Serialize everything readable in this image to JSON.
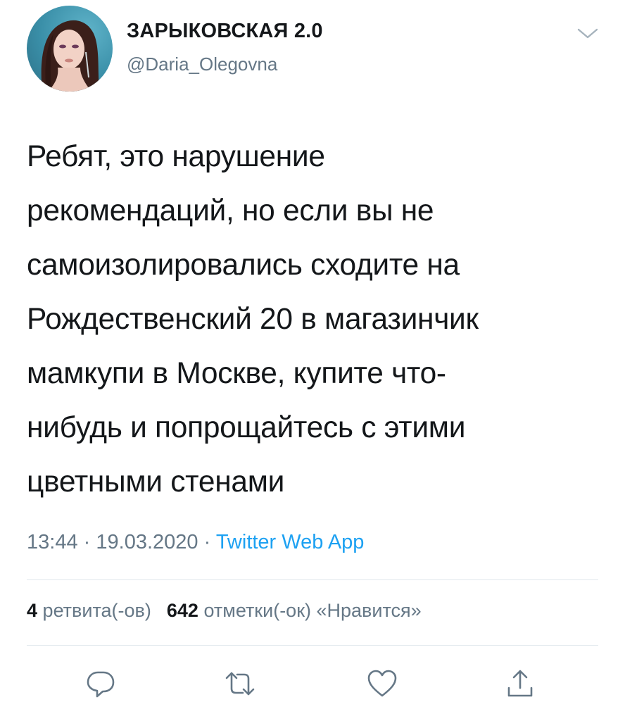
{
  "author": {
    "display_name": "ЗАРЫКОВСКАЯ 2.0",
    "handle": "@Daria_Olegovna",
    "avatar_icon": "profile-photo"
  },
  "tweet": {
    "lines": [
      "Ребят, это нарушение",
      "рекомендаций, но если вы не",
      "самоизолировались сходите на",
      "Рождественский 20 в магазинчик",
      "мамкупи в Москве, купите что-",
      "нибудь и попрощайтесь с этими",
      "цветными стенами"
    ],
    "time": "13:44",
    "separator": "·",
    "date": "19.03.2020",
    "source": "Twitter Web App"
  },
  "stats": {
    "retweets_count": "4",
    "retweets_label": "ретвита(-ов)",
    "likes_count": "642",
    "likes_label": "отметки(-ок) «Нравится»"
  },
  "actions": {
    "reply_icon": "reply-icon",
    "retweet_icon": "retweet-icon",
    "like_icon": "like-icon",
    "share_icon": "share-icon"
  },
  "colors": {
    "text": "#14171a",
    "secondary": "#657786",
    "link": "#1da1f2",
    "divider": "#e1e8ed"
  }
}
